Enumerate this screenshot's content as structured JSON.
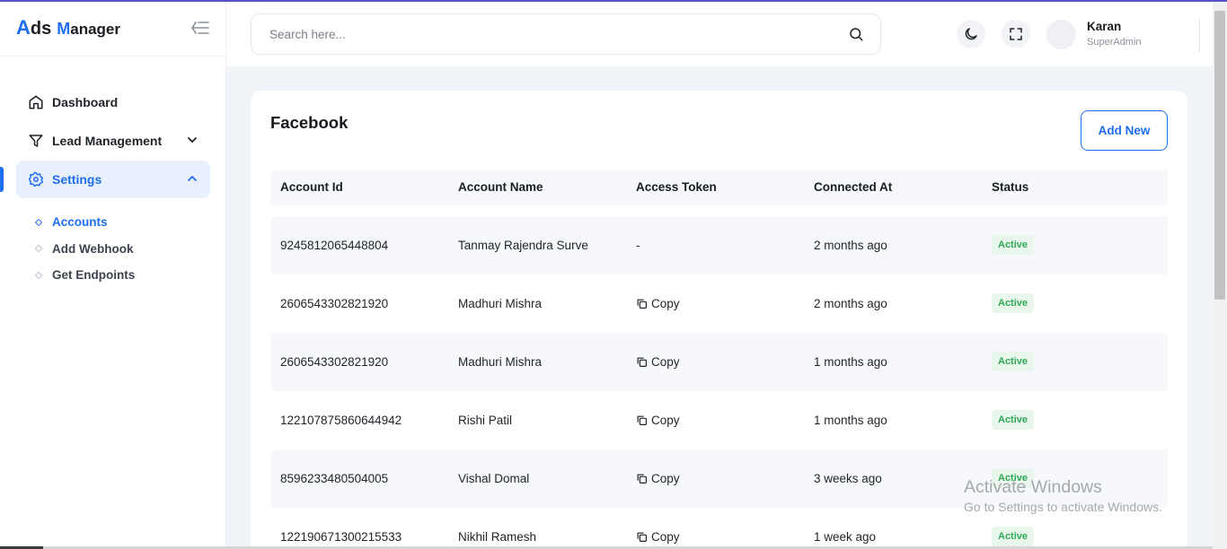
{
  "brand": {
    "big_a": "A",
    "rest_a": "ds",
    "big_b": "M",
    "rest_b": "anager"
  },
  "search": {
    "placeholder": "Search here..."
  },
  "user": {
    "name": "Karan",
    "role": "SuperAdmin"
  },
  "sidebar": {
    "items": [
      {
        "label": "Dashboard",
        "icon": "home-icon"
      },
      {
        "label": "Lead Management",
        "icon": "filter-icon"
      },
      {
        "label": "Settings",
        "icon": "gear-icon"
      }
    ],
    "sub_items": [
      {
        "label": "Accounts"
      },
      {
        "label": "Add Webhook"
      },
      {
        "label": "Get Endpoints"
      }
    ]
  },
  "card": {
    "title": "Facebook",
    "add_label": "Add New",
    "columns": [
      "Account Id",
      "Account Name",
      "Access Token",
      "Connected At",
      "Status"
    ],
    "rows": [
      {
        "id": "9245812065448804",
        "name": "Tanmay Rajendra Surve",
        "token": "-",
        "connected": "2 months ago",
        "status": "Active"
      },
      {
        "id": "2606543302821920",
        "name": "Madhuri Mishra",
        "token": "Copy",
        "connected": "2 months ago",
        "status": "Active"
      },
      {
        "id": "2606543302821920",
        "name": "Madhuri Mishra",
        "token": "Copy",
        "connected": "1 months ago",
        "status": "Active"
      },
      {
        "id": "122107875860644942",
        "name": "Rishi Patil",
        "token": "Copy",
        "connected": "1 months ago",
        "status": "Active"
      },
      {
        "id": "8596233480504005",
        "name": "Vishal Domal",
        "token": "Copy",
        "connected": "3 weeks ago",
        "status": "Active"
      },
      {
        "id": "122190671300215533",
        "name": "Nikhil Ramesh",
        "token": "Copy",
        "connected": "1 week ago",
        "status": "Active"
      }
    ]
  },
  "watermark": {
    "line1": "Activate Windows",
    "line2": "Go to Settings to activate Windows."
  },
  "colors": {
    "accent": "#1f6ef0",
    "status_active": "#2eaa55",
    "status_bg": "#e8f6ec"
  }
}
